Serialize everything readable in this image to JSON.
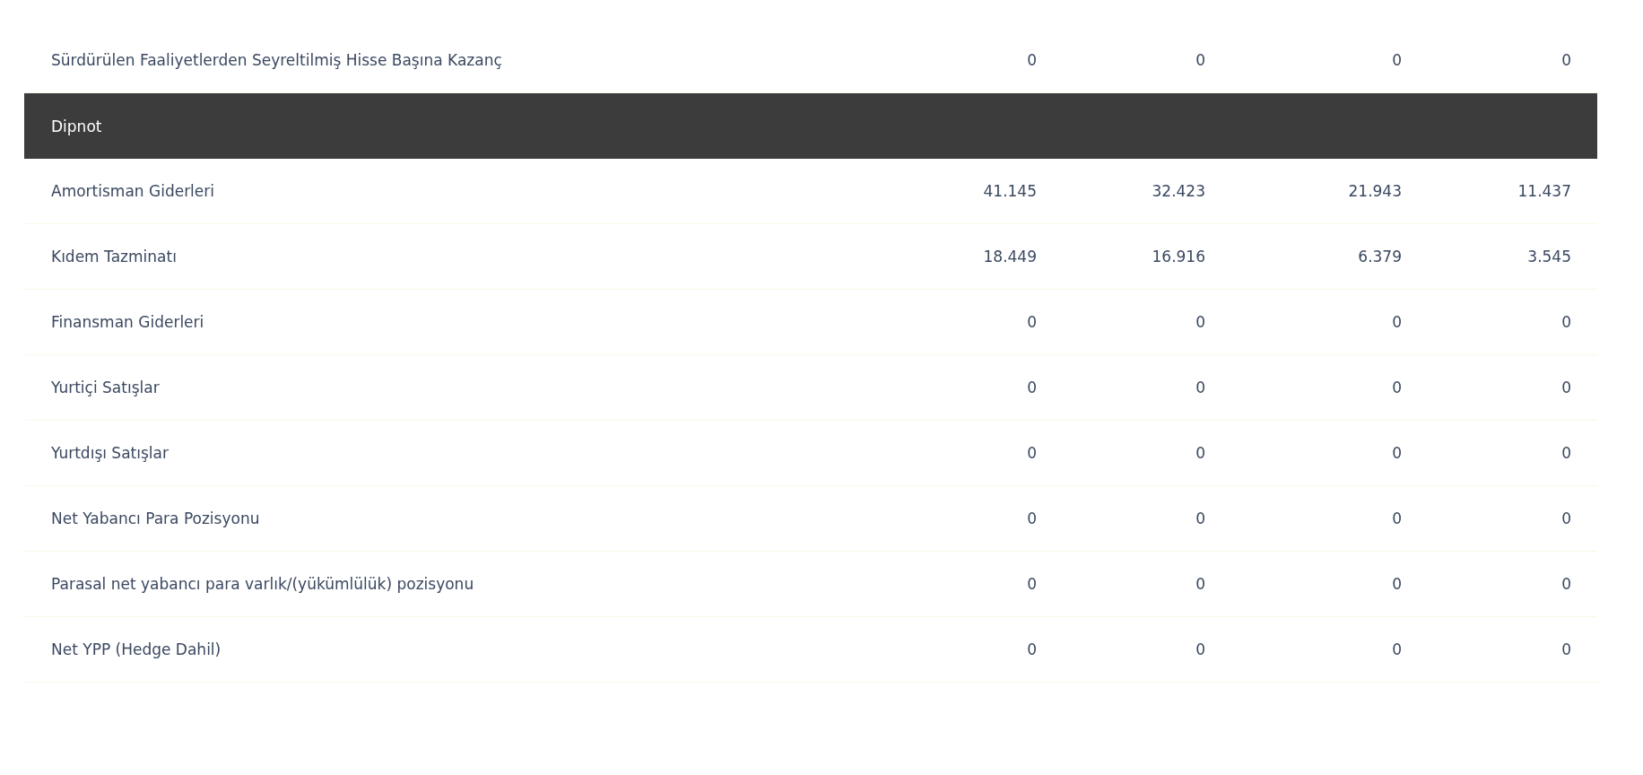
{
  "rows": [
    {
      "kind": "row",
      "label": "Sürdürülen Faaliyetlerden Seyreltilmiş Hisse Başına Kazanç",
      "values": [
        "0",
        "0",
        "0",
        "0"
      ]
    },
    {
      "kind": "section",
      "label": "Dipnot"
    },
    {
      "kind": "row",
      "label": "Amortisman Giderleri",
      "values": [
        "41.145",
        "32.423",
        "21.943",
        "11.437"
      ]
    },
    {
      "kind": "row",
      "label": "Kıdem Tazminatı",
      "values": [
        "18.449",
        "16.916",
        "6.379",
        "3.545"
      ]
    },
    {
      "kind": "row",
      "label": "Finansman Giderleri",
      "values": [
        "0",
        "0",
        "0",
        "0"
      ]
    },
    {
      "kind": "row",
      "label": "Yurtiçi Satışlar",
      "values": [
        "0",
        "0",
        "0",
        "0"
      ]
    },
    {
      "kind": "row",
      "label": "Yurtdışı Satışlar",
      "values": [
        "0",
        "0",
        "0",
        "0"
      ]
    },
    {
      "kind": "row",
      "label": "Net Yabancı Para Pozisyonu",
      "values": [
        "0",
        "0",
        "0",
        "0"
      ]
    },
    {
      "kind": "row",
      "label": "Parasal net yabancı para varlık/(yükümlülük) pozisyonu",
      "values": [
        "0",
        "0",
        "0",
        "0"
      ]
    },
    {
      "kind": "row",
      "label": "Net YPP (Hedge Dahil)",
      "values": [
        "0",
        "0",
        "0",
        "0"
      ]
    }
  ]
}
